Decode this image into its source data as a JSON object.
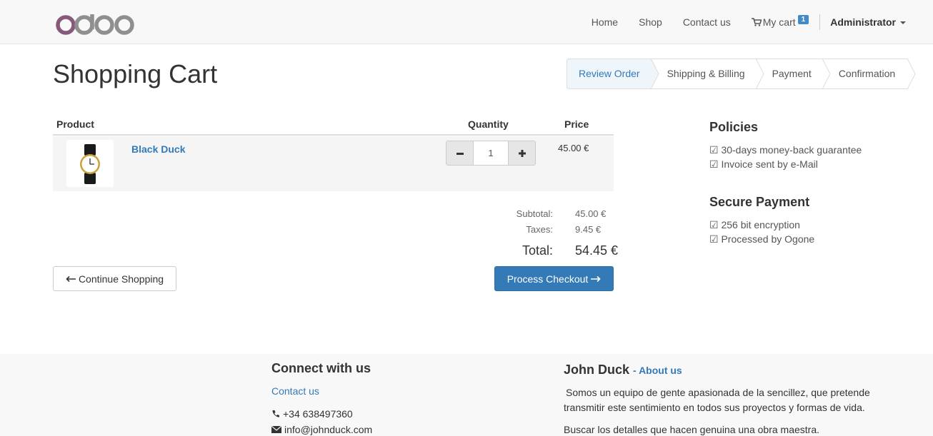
{
  "navbar": {
    "logo_text": "odoo",
    "links": [
      "Home",
      "Shop",
      "Contact us"
    ],
    "cart_label": "My cart",
    "cart_count": "1",
    "user": "Administrator"
  },
  "page": {
    "title": "Shopping Cart"
  },
  "wizard": {
    "steps": [
      "Review Order",
      "Shipping & Billing",
      "Payment",
      "Confirmation"
    ],
    "active_step": "Review Order"
  },
  "cart": {
    "headers": {
      "product": "Product",
      "quantity": "Quantity",
      "price": "Price"
    },
    "items": [
      {
        "name": "Black Duck",
        "quantity": "1",
        "price": "45.00 €"
      }
    ],
    "subtotal_label": "Subtotal:",
    "subtotal": "45.00 €",
    "taxes_label": "Taxes:",
    "taxes": "9.45 €",
    "total_label": "Total:",
    "total": "54.45 €",
    "continue_label": "Continue Shopping",
    "checkout_label": "Process Checkout"
  },
  "sidebar": {
    "policies_title": "Policies",
    "policies": [
      "☑ 30-days money-back guarantee",
      "☑ Invoice sent by e-Mail"
    ],
    "payment_title": "Secure Payment",
    "payment": [
      "☑ 256 bit encryption",
      "☑ Processed by Ogone"
    ]
  },
  "footer": {
    "connect_title": "Connect with us",
    "contact_link": "Contact us",
    "phone": "+34 638497360",
    "email": "info@johnduck.com",
    "about_title": "John Duck",
    "about_link": "- About us",
    "about_text_1": "Somos un equipo de gente apasionada de la sencillez, que pretende",
    "about_text_2": "transmitir este sentimiento en todos sus proyectos y formas de vida.",
    "about_text_3": "Buscar los detalles que hacen genuina una obra maestra."
  },
  "colors": {
    "brand_purple": "#875a7b",
    "link_blue": "#337ab7",
    "primary_button": "#337ab7"
  }
}
